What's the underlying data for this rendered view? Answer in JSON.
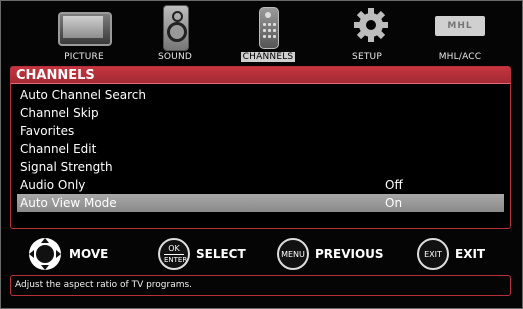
{
  "tabs": [
    {
      "label": "PICTURE",
      "icon": "tv-icon"
    },
    {
      "label": "SOUND",
      "icon": "speaker-icon"
    },
    {
      "label": "CHANNELS",
      "icon": "remote-icon",
      "active": true
    },
    {
      "label": "SETUP",
      "icon": "gear-icon"
    },
    {
      "label": "MHL/ACC",
      "icon": "mhl-icon",
      "badge": "MHL"
    }
  ],
  "panel": {
    "title": "CHANNELS",
    "items": [
      {
        "label": "Auto Channel Search",
        "value": ""
      },
      {
        "label": "Channel Skip",
        "value": ""
      },
      {
        "label": "Favorites",
        "value": ""
      },
      {
        "label": "Channel Edit",
        "value": ""
      },
      {
        "label": "Signal Strength",
        "value": ""
      },
      {
        "label": "Audio Only",
        "value": "Off"
      },
      {
        "label": "Auto View Mode",
        "value": "On",
        "selected": true
      }
    ]
  },
  "controls": {
    "move": "MOVE",
    "select": "SELECT",
    "ok_top": "OK",
    "ok_bottom": "ENTER",
    "previous": "PREVIOUS",
    "menu_btn": "MENU",
    "exit": "EXIT",
    "exit_btn": "EXIT"
  },
  "help": "Adjust the aspect ratio of  TV programs.",
  "colors": {
    "accent": "#b8313a",
    "selected": "#9a9a9a"
  }
}
